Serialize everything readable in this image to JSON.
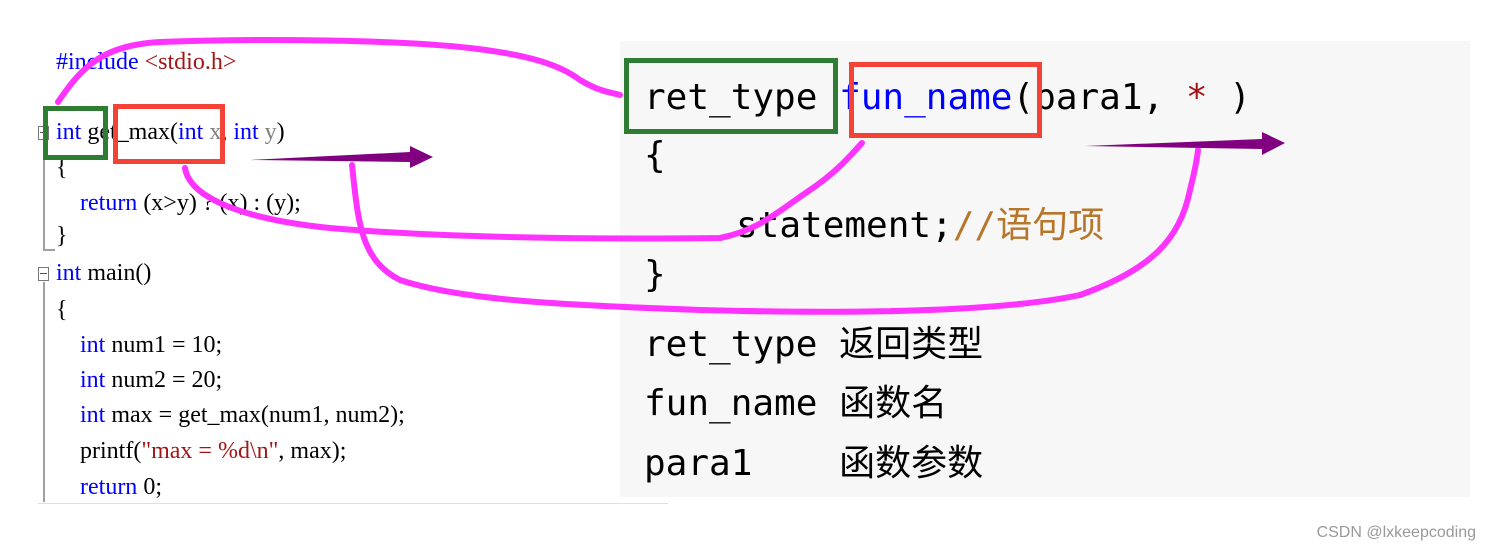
{
  "left_code": {
    "lines": [
      {
        "parts": [
          {
            "t": "#include ",
            "c": "kw"
          },
          {
            "t": "<stdio.h>",
            "c": "str"
          }
        ]
      },
      {
        "parts": []
      },
      {
        "parts": [
          {
            "t": "int",
            "c": "kw"
          },
          {
            "t": " get_max(",
            "c": ""
          },
          {
            "t": "int",
            "c": "kw"
          },
          {
            "t": " x",
            "c": "param"
          },
          {
            "t": ", ",
            "c": ""
          },
          {
            "t": "int",
            "c": "kw"
          },
          {
            "t": " y",
            "c": "param"
          },
          {
            "t": ")",
            "c": ""
          }
        ]
      },
      {
        "parts": [
          {
            "t": "{",
            "c": ""
          }
        ]
      },
      {
        "parts": [
          {
            "t": "    return",
            "c": "kw"
          },
          {
            "t": " (x>y) ? (x) : (y);",
            "c": ""
          }
        ]
      },
      {
        "parts": [
          {
            "t": "}",
            "c": ""
          }
        ]
      },
      {
        "parts": [
          {
            "t": "int",
            "c": "kw"
          },
          {
            "t": " main()",
            "c": ""
          }
        ]
      },
      {
        "parts": [
          {
            "t": "{",
            "c": ""
          }
        ]
      },
      {
        "parts": [
          {
            "t": "    int",
            "c": "kw"
          },
          {
            "t": " num1 = 10;",
            "c": ""
          }
        ]
      },
      {
        "parts": [
          {
            "t": "    int",
            "c": "kw"
          },
          {
            "t": " num2 = 20;",
            "c": ""
          }
        ]
      },
      {
        "parts": [
          {
            "t": "    int",
            "c": "kw"
          },
          {
            "t": " max = get_max(num1, num2);",
            "c": ""
          }
        ]
      },
      {
        "parts": [
          {
            "t": "    printf(",
            "c": ""
          },
          {
            "t": "\"max = %d\\n\"",
            "c": "str"
          },
          {
            "t": ", max);",
            "c": ""
          }
        ]
      },
      {
        "parts": [
          {
            "t": "    return",
            "c": "kw"
          },
          {
            "t": " 0;",
            "c": ""
          }
        ]
      }
    ]
  },
  "right_code": {
    "signature": {
      "ret_type": "ret_type",
      "fun_name": "fun_name",
      "open": "(para1, ",
      "star": "*",
      "close": " )"
    },
    "open_brace": "{",
    "statement": "statement;",
    "comment": "//语句项",
    "close_brace": "}",
    "legend": [
      {
        "term": "ret_type",
        "desc": "返回类型"
      },
      {
        "term": "fun_name",
        "desc": "函数名"
      },
      {
        "term": "para1   ",
        "desc": "函数参数"
      }
    ]
  },
  "colors": {
    "annotation": "#ff33ff",
    "arrow": "#800080",
    "green_box": "#2e7d32",
    "red_box": "#f44336"
  },
  "watermark": "CSDN @lxkeepcoding"
}
